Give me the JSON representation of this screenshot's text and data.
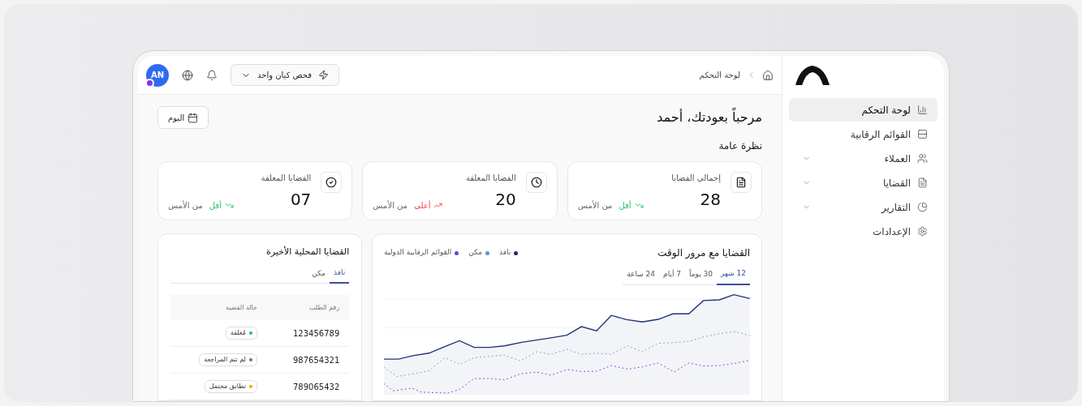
{
  "sidebar": {
    "items": [
      {
        "label": "لوحة التحكم",
        "selected": true,
        "expandable": false
      },
      {
        "label": "القوائم الرقابية",
        "selected": false,
        "expandable": false
      },
      {
        "label": "العملاء",
        "selected": false,
        "expandable": true
      },
      {
        "label": "القضايا",
        "selected": false,
        "expandable": true
      },
      {
        "label": "التقارير",
        "selected": false,
        "expandable": true
      },
      {
        "label": "الإعدادات",
        "selected": false,
        "expandable": false
      }
    ]
  },
  "header": {
    "breadcrumb": "لوحة التحكم",
    "action_button": "فحص كيان واحد",
    "avatar": "AN"
  },
  "welcome": "مرحباً بعودتك، أحمد",
  "date_button": "اليوم",
  "overview_title": "نظرة عامة",
  "stats": [
    {
      "label": "إجمالي القضايا",
      "value": "28",
      "kind": "down",
      "trend_label": "أقل",
      "trend_suffix": "من الأمس"
    },
    {
      "label": "القضايا المعلقة",
      "value": "20",
      "kind": "up",
      "trend_label": "أعلى",
      "trend_suffix": "من الأمس"
    },
    {
      "label": "القضايا المغلقة",
      "value": "07",
      "kind": "down",
      "trend_label": "أقل",
      "trend_suffix": "من الأمس"
    }
  ],
  "chart_card": {
    "title": "القضايا مع مرور الوقت",
    "legend": [
      {
        "label": "نافذ",
        "color": "#1e2a78"
      },
      {
        "label": "مكن",
        "color": "#6b8fd6"
      },
      {
        "label": "القوائم الرقابية الدولية",
        "color": "#6d3fd6"
      }
    ],
    "tabs": [
      {
        "label": "12 شهر",
        "selected": true
      },
      {
        "label": "30 يوماً",
        "selected": false
      },
      {
        "label": "7 أيام",
        "selected": false
      },
      {
        "label": "24 ساعة",
        "selected": false
      }
    ]
  },
  "recent_cases": {
    "title": "القضايا المحلية الأخيرة",
    "tabs": [
      {
        "label": "نافذ",
        "selected": true
      },
      {
        "label": "مكن",
        "selected": false
      }
    ],
    "columns": [
      "رقم الطلب",
      "حالة القضية"
    ],
    "rows": [
      {
        "request": "123456789",
        "status": "مُغلقة",
        "color": "#22c55e"
      },
      {
        "request": "987654321",
        "status": "لم تتم المراجعة",
        "color": "#6b7280"
      },
      {
        "request": "789065432",
        "status": "تطابق محتمل",
        "color": "#f59e0b"
      }
    ]
  }
}
